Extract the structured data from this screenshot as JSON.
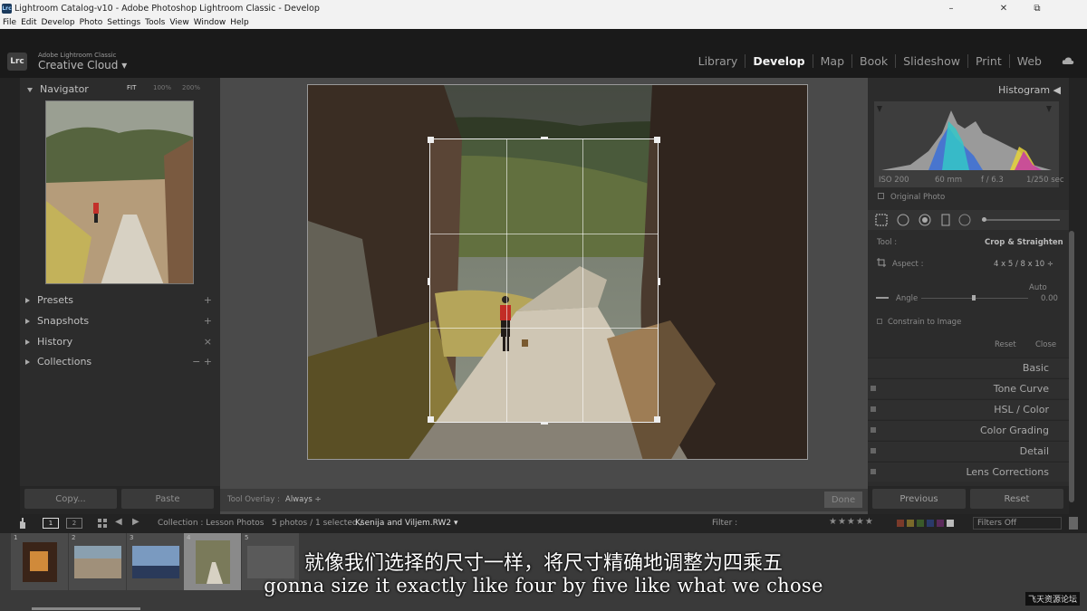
{
  "window": {
    "title": "Lightroom Catalog-v10 - Adobe Photoshop Lightroom Classic - Develop",
    "app_icon": "Lrc",
    "controls": {
      "minimize": "–",
      "restore": "⧉",
      "close": "✕"
    }
  },
  "menu": [
    "File",
    "Edit",
    "Develop",
    "Photo",
    "Settings",
    "Tools",
    "View",
    "Window",
    "Help"
  ],
  "identity": {
    "logo": "Lrc",
    "small": "Adobe Lightroom Classic",
    "big": "Creative Cloud ▾"
  },
  "modules": [
    "Library",
    "Develop",
    "Map",
    "Book",
    "Slideshow",
    "Print",
    "Web"
  ],
  "active_module": "Develop",
  "left_panel": {
    "navigator": {
      "title": "Navigator",
      "zoom": [
        "FIT",
        "100%",
        "200%"
      ]
    },
    "sections": [
      {
        "label": "Presets",
        "action": "+"
      },
      {
        "label": "Snapshots",
        "action": "+"
      },
      {
        "label": "History",
        "action": "×"
      },
      {
        "label": "Collections",
        "action": "− +"
      }
    ],
    "copy_button": "Copy...",
    "paste_button": "Paste"
  },
  "center": {
    "tool_overlay_label": "Tool Overlay :",
    "tool_overlay_value": "Always ÷",
    "done_button": "Done"
  },
  "right_panel": {
    "histogram_title": "Histogram ◀",
    "exif": [
      "ISO 200",
      "60 mm",
      "f / 6.3",
      "1/250 sec"
    ],
    "original_photo": "Original Photo",
    "tool_label": "Tool :",
    "tool_value": "Crop & Straighten",
    "aspect_label": "Aspect :",
    "aspect_value": "4 x 5 / 8 x 10 ÷",
    "auto_label": "Auto",
    "angle_label": "Angle",
    "angle_value": "0.00",
    "constrain_label": "Constrain to Image",
    "reset_small": "Reset",
    "close_small": "Close",
    "sections": [
      "Basic",
      "Tone Curve",
      "HSL / Color",
      "Color Grading",
      "Detail",
      "Lens Corrections"
    ],
    "previous_button": "Previous",
    "reset_button": "Reset"
  },
  "filmstrip_bar": {
    "views": [
      "1",
      "2"
    ],
    "source": "Collection : Lesson Photos",
    "count": "5 photos / 1 selected /",
    "filename": "Ksenija and Viljem.RW2 ▾",
    "filter_label": "Filter :",
    "stars": "★★★★★",
    "filters_off": "Filters Off"
  },
  "filmstrip": {
    "numbers": [
      "1",
      "2",
      "3",
      "4",
      "5"
    ],
    "selected_index": 3
  },
  "subtitles": {
    "chinese": "就像我们选择的尺寸一样，将尺寸精确地调整为四乘五",
    "english": "gonna size it exactly like four by five like what we chose"
  },
  "watermark": "飞天资源论坛"
}
